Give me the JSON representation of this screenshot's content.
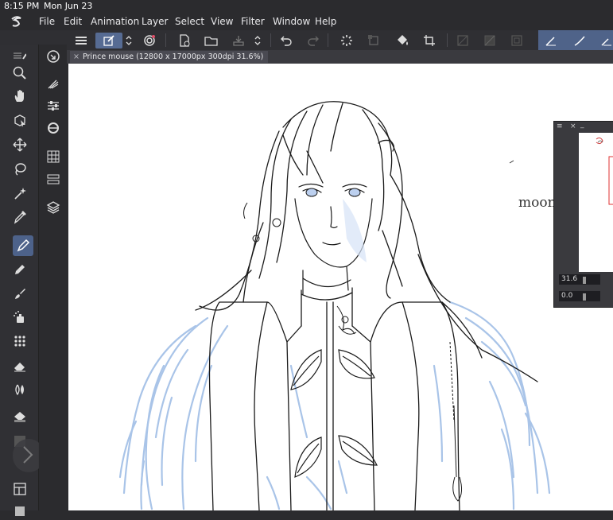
{
  "status_bar": {
    "time": "8:15 PM",
    "date": "Mon Jun 23"
  },
  "menu": {
    "items": [
      "File",
      "Edit",
      "Animation",
      "Layer",
      "Select",
      "View",
      "Filter",
      "Window",
      "Help"
    ]
  },
  "left_panel": {
    "collapse_left": "«",
    "collapse_right": "»",
    "collapse_left2": "«",
    "arrow": "›"
  },
  "document_tab": {
    "close": "×",
    "title": "Prince mouse (12800 x 17000px 300dpi 31.6%)"
  },
  "canvas": {
    "handwritten_text": "moon"
  },
  "navigator": {
    "zoom_value": "31.6",
    "rotation_value": "0.0",
    "close": "×",
    "minimize": "_"
  },
  "colors": {
    "accent": "#4d628a",
    "sketch_blue": "#a9c4e8",
    "lineart": "#1a1a1a"
  }
}
